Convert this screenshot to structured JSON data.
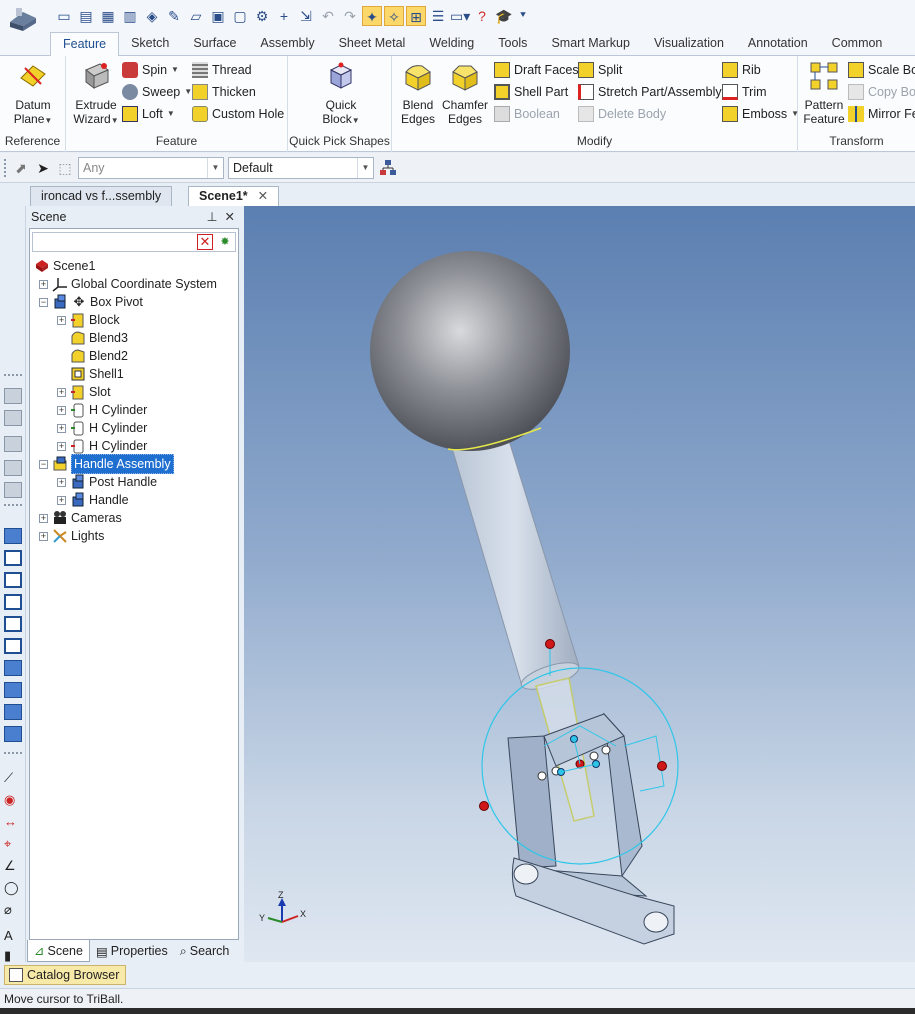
{
  "ribbon_tabs": [
    "Feature",
    "Sketch",
    "Surface",
    "Assembly",
    "Sheet Metal",
    "Welding",
    "Tools",
    "Smart Markup",
    "Visualization",
    "Annotation",
    "Common"
  ],
  "ribbon": {
    "reference": {
      "label": "Reference",
      "datum_plane": "Datum Plane"
    },
    "feature": {
      "label": "Feature",
      "extrude_wizard": "Extrude Wizard",
      "spin": "Spin",
      "sweep": "Sweep",
      "loft": "Loft",
      "thread": "Thread",
      "thicken": "Thicken",
      "custom_hole": "Custom Hole"
    },
    "quick_pick": {
      "label": "Quick Pick Shapes",
      "quick_block": "Quick Block"
    },
    "modify": {
      "label": "Modify",
      "blend_edges": "Blend Edges",
      "chamfer_edges": "Chamfer Edges",
      "draft_faces": "Draft Faces",
      "shell_part": "Shell Part",
      "boolean": "Boolean",
      "split": "Split",
      "stretch": "Stretch Part/Assembly",
      "delete_body": "Delete Body",
      "rib": "Rib",
      "trim": "Trim",
      "emboss": "Emboss"
    },
    "transform": {
      "label": "Transform",
      "pattern_feature": "Pattern Feature",
      "scale_body": "Scale Bod",
      "copy_body": "Copy Bod",
      "mirror_feature": "Mirror Fe"
    }
  },
  "selection_toolbar": {
    "filter_value": "Any",
    "style_value": "Default"
  },
  "doc_tabs": [
    {
      "label": "ironcad vs f...ssembly"
    },
    {
      "label": "Scene1*"
    }
  ],
  "scene_panel": {
    "title": "Scene",
    "tree": [
      {
        "label": "Scene1"
      },
      {
        "label": "Global Coordinate System"
      },
      {
        "label": "Box Pivot"
      },
      {
        "label": "Block"
      },
      {
        "label": "Blend3"
      },
      {
        "label": "Blend2"
      },
      {
        "label": "Shell1"
      },
      {
        "label": "Slot"
      },
      {
        "label": "H Cylinder"
      },
      {
        "label": "H Cylinder"
      },
      {
        "label": "H Cylinder"
      },
      {
        "label": "Handle Assembly"
      },
      {
        "label": "Post Handle"
      },
      {
        "label": "Handle"
      },
      {
        "label": "Cameras"
      },
      {
        "label": "Lights"
      }
    ],
    "tabs": [
      "Scene",
      "Properties",
      "Search"
    ]
  },
  "axes": {
    "x": "X",
    "y": "Y",
    "z": "Z"
  },
  "catalog_browser": "Catalog Browser",
  "status_text": "Move cursor to TriBall."
}
